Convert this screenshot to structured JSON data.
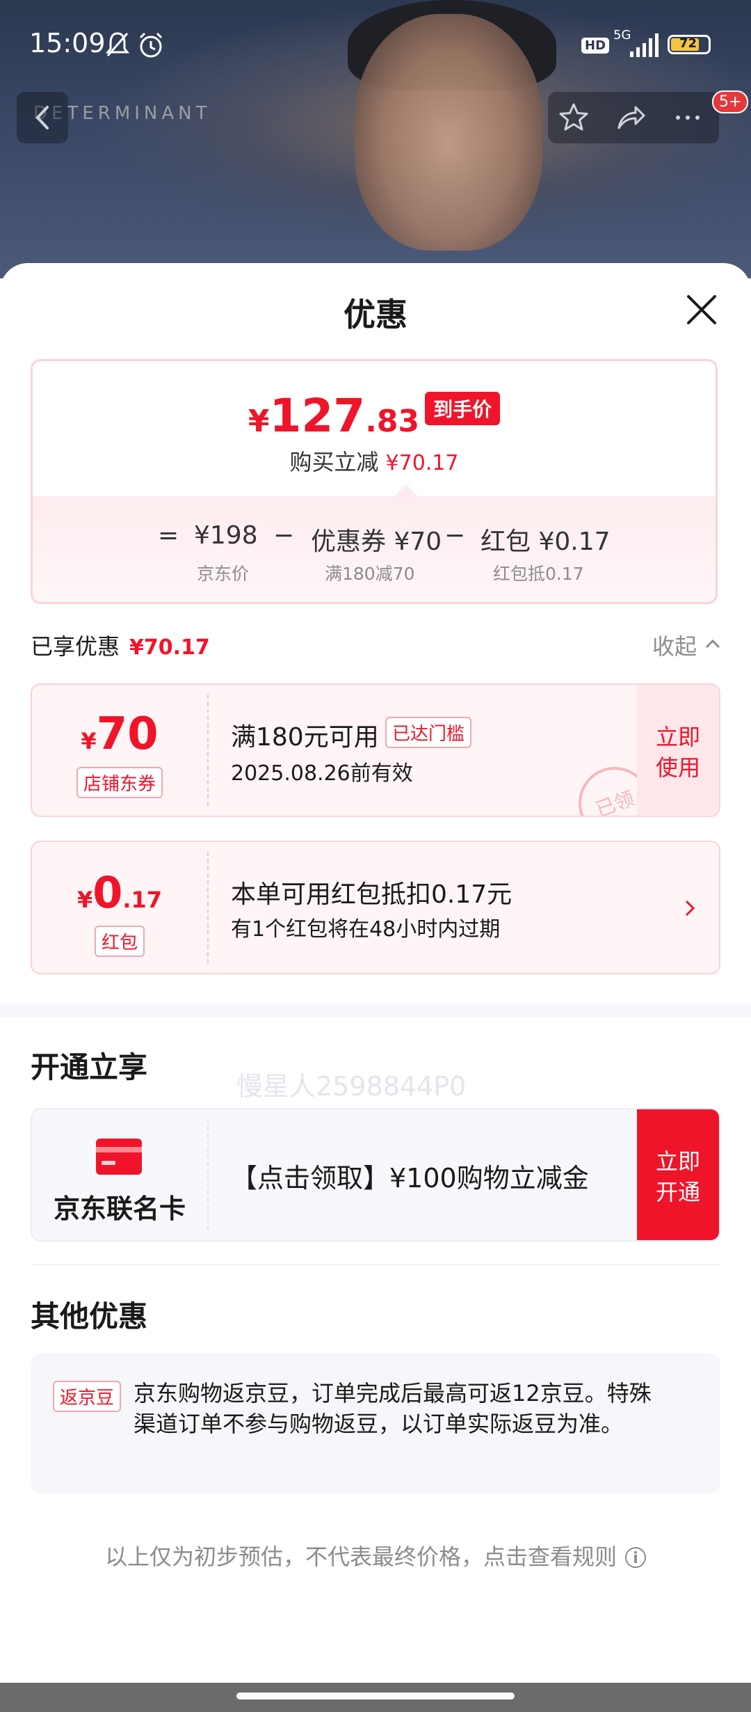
{
  "status_bar": {
    "time": "15:09",
    "hd": "HD",
    "network": "5G",
    "battery": "72"
  },
  "hero": {
    "brand_en": "DETERMINANT",
    "badge": "5+"
  },
  "sheet": {
    "title": "优惠"
  },
  "price_summary": {
    "currency": "¥",
    "price_int": "127",
    "price_dec": ".83",
    "price_tag": "到手价",
    "reduce_label": "购买立减",
    "reduce_amount": "¥70.17",
    "formula": {
      "equals": "=",
      "jd_price": "¥198",
      "minus1": "−",
      "coupon": "优惠券 ¥70",
      "minus2": "−",
      "redpacket": "红包 ¥0.17",
      "jd_price_label": "京东价",
      "coupon_label": "满180减70",
      "redpacket_label": "红包抵0.17"
    }
  },
  "enjoyed": {
    "label": "已享优惠",
    "amount": "¥70.17",
    "collapse": "收起"
  },
  "coupon_store": {
    "currency": "¥",
    "value": "70",
    "chip": "店铺东券",
    "title": "满180元可用",
    "status": "已达门槛",
    "validity": "2025.08.26前有效",
    "action_line1": "立即",
    "action_line2": "使用",
    "stamp": "已领"
  },
  "watermark": "慢星人2598844P0",
  "coupon_redpacket": {
    "currency": "¥",
    "value_int": "0",
    "value_dec": ".17",
    "chip": "红包",
    "title": "本单可用红包抵扣0.17元",
    "sub": "有1个红包将在48小时内过期"
  },
  "open_section": {
    "title": "开通立享",
    "card_name": "京东联名卡",
    "desc": "【点击领取】¥100购物立减金",
    "action_line1": "立即",
    "action_line2": "开通"
  },
  "other_section": {
    "title": "其他优惠",
    "tag": "返京豆",
    "text": "京东购物返京豆，订单完成后最高可返12京豆。特殊渠道订单不参与购物返豆，以订单实际返豆为准。"
  },
  "disclaimer": "以上仅为初步预估，不代表最终价格，点击查看规则",
  "colors": {
    "accent": "#f0142a",
    "accent_light": "#fde7ea",
    "text": "#1a1a1a",
    "muted": "#8c8c8c"
  }
}
